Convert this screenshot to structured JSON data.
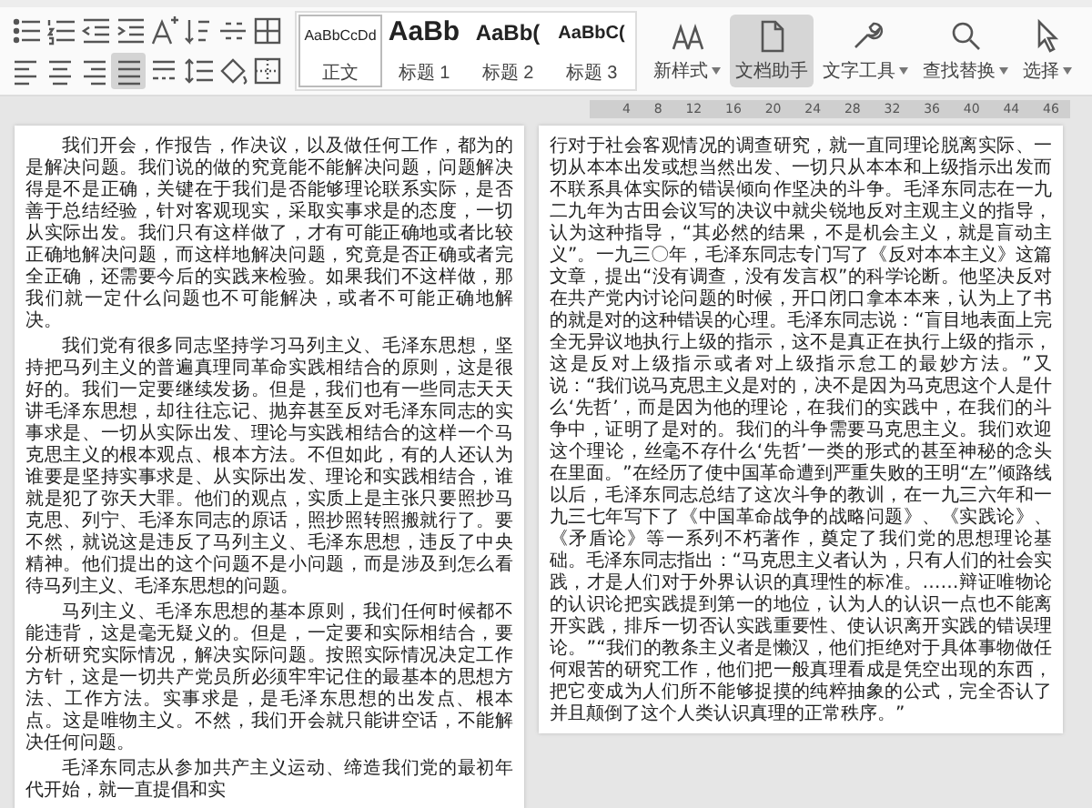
{
  "toolbar": {
    "format_rows": [
      [
        {
          "kind": "bullets",
          "selected": false
        },
        {
          "kind": "numbering",
          "selected": false
        },
        {
          "kind": "outdent",
          "selected": false
        },
        {
          "kind": "indent",
          "selected": false
        },
        {
          "kind": "fontsize",
          "selected": false
        },
        {
          "kind": "sort",
          "selected": false
        },
        {
          "kind": "spacing",
          "selected": false
        },
        {
          "kind": "grid",
          "selected": false
        }
      ],
      [
        {
          "kind": "align-left",
          "selected": false
        },
        {
          "kind": "align-center",
          "selected": false
        },
        {
          "kind": "align-right",
          "selected": false
        },
        {
          "kind": "justify",
          "selected": true
        },
        {
          "kind": "distribute",
          "selected": false
        },
        {
          "kind": "linespacing",
          "selected": false
        },
        {
          "kind": "fill",
          "selected": false
        },
        {
          "kind": "border",
          "selected": false
        }
      ]
    ],
    "styles": [
      {
        "kind": "body",
        "preview": "AaBbCcDd",
        "label": "正文",
        "selected": true
      },
      {
        "kind": "h1",
        "preview": "AaBb",
        "label": "标题 1",
        "selected": false
      },
      {
        "kind": "h2",
        "preview": "AaBb(",
        "label": "标题 2",
        "selected": false
      },
      {
        "kind": "h3",
        "preview": "AaBbC(",
        "label": "标题 3",
        "selected": false
      }
    ],
    "tools": [
      {
        "kind": "new-style",
        "label": "新样式",
        "dropdown": true,
        "selected": false
      },
      {
        "kind": "assistant",
        "label": "文档助手",
        "dropdown": false,
        "selected": true
      },
      {
        "kind": "text-tools",
        "label": "文字工具",
        "dropdown": true,
        "selected": false
      },
      {
        "kind": "find",
        "label": "查找替换",
        "dropdown": true,
        "selected": false
      },
      {
        "kind": "select",
        "label": "选择",
        "dropdown": true,
        "selected": false
      }
    ]
  },
  "ruler": {
    "ticks": [
      "4",
      "8",
      "12",
      "16",
      "20",
      "24",
      "28",
      "32",
      "36",
      "40",
      "44",
      "46"
    ]
  },
  "pages": [
    {
      "continued": false,
      "paragraphs": [
        "我们开会，作报告，作决议，以及做任何工作，都为的是解决问题。我们说的做的究竟能不能解决问题，问题解决得是不是正确，关键在于我们是否能够理论联系实际，是否善于总结经验，针对客观现实，采取实事求是的态度，一切从实际出发。我们只有这样做了，才有可能正确地或者比较正确地解决问题，而这样地解决问题，究竟是否正确或者完全正确，还需要今后的实践来检验。如果我们不这样做，那我们就一定什么问题也不可能解决，或者不可能正确地解决。",
        "我们党有很多同志坚持学习马列主义、毛泽东思想，坚持把马列主义的普遍真理同革命实践相结合的原则，这是很好的。我们一定要继续发扬。但是，我们也有一些同志天天讲毛泽东思想，却往往忘记、抛弃甚至反对毛泽东同志的实事求是、一切从实际出发、理论与实践相结合的这样一个马克思主义的根本观点、根本方法。不但如此，有的人还认为谁要是坚持实事求是、从实际出发、理论和实践相结合，谁就是犯了弥天大罪。他们的观点，实质上是主张只要照抄马克思、列宁、毛泽东同志的原话，照抄照转照搬就行了。要不然，就说这是违反了马列主义、毛泽东思想，违反了中央精神。他们提出的这个问题不是小问题，而是涉及到怎么看待马列主义、毛泽东思想的问题。",
        "马列主义、毛泽东思想的基本原则，我们任何时候都不能违背，这是毫无疑义的。但是，一定要和实际相结合，要分析研究实际情况，解决实际问题。按照实际情况决定工作方针，这是一切共产党员所必须牢牢记住的最基本的思想方法、工作方法。实事求是，是毛泽东思想的出发点、根本点。这是唯物主义。不然，我们开会就只能讲空话，不能解决任何问题。",
        "毛泽东同志从参加共产主义运动、缔造我们党的最初年代开始，就一直提倡和实"
      ]
    },
    {
      "continued": true,
      "paragraphs": [
        "行对于社会客观情况的调查研究，就一直同理论脱离实际、一切从本本出发或想当然出发、一切只从本本和上级指示出发而不联系具体实际的错误倾向作坚决的斗争。毛泽东同志在一九二九年为古田会议写的决议中就尖锐地反对主观主义的指导，认为这种指导，“其必然的结果，不是机会主义，就是盲动主义”。一九三〇年，毛泽东同志专门写了《反对本本主义》这篇文章，提出“没有调查，没有发言权”的科学论断。他坚决反对在共产党内讨论问题的时候，开口闭口拿本本来，认为上了书的就是对的这种错误的心理。毛泽东同志说：“盲目地表面上完全无异议地执行上级的指示，这不是真正在执行上级的指示，这是反对上级指示或者对上级指示怠工的最妙方法。”又说：“我们说马克思主义是对的，决不是因为马克思这个人是什么‘先哲’，而是因为他的理论，在我们的实践中，在我们的斗争中，证明了是对的。我们的斗争需要马克思主义。我们欢迎这个理论，丝毫不存什么‘先哲’一类的形式的甚至神秘的念头在里面。”在经历了使中国革命遭到严重失败的王明“左”倾路线以后，毛泽东同志总结了这次斗争的教训，在一九三六年和一九三七年写下了《中国革命战争的战略问题》、《实践论》、《矛盾论》等一系列不朽著作，奠定了我们党的思想理论基础。毛泽东同志指出：“马克思主义者认为，只有人们的社会实践，才是人们对于外界认识的真理性的标准。……辩证唯物论的认识论把实践提到第一的地位，认为人的认识一点也不能离开实践，排斥一切否认实践重要性、使认识离开实践的错误理论。”“我们的教条主义者是懒汉，他们拒绝对于具体事物做任何艰苦的研究工作，他们把一般真理看成是凭空出现的东西，把它变成为人们所不能够捉摸的纯粹抽象的公式，完全否认了并且颠倒了这个人类认识真理的正常秩序。”"
      ]
    }
  ]
}
